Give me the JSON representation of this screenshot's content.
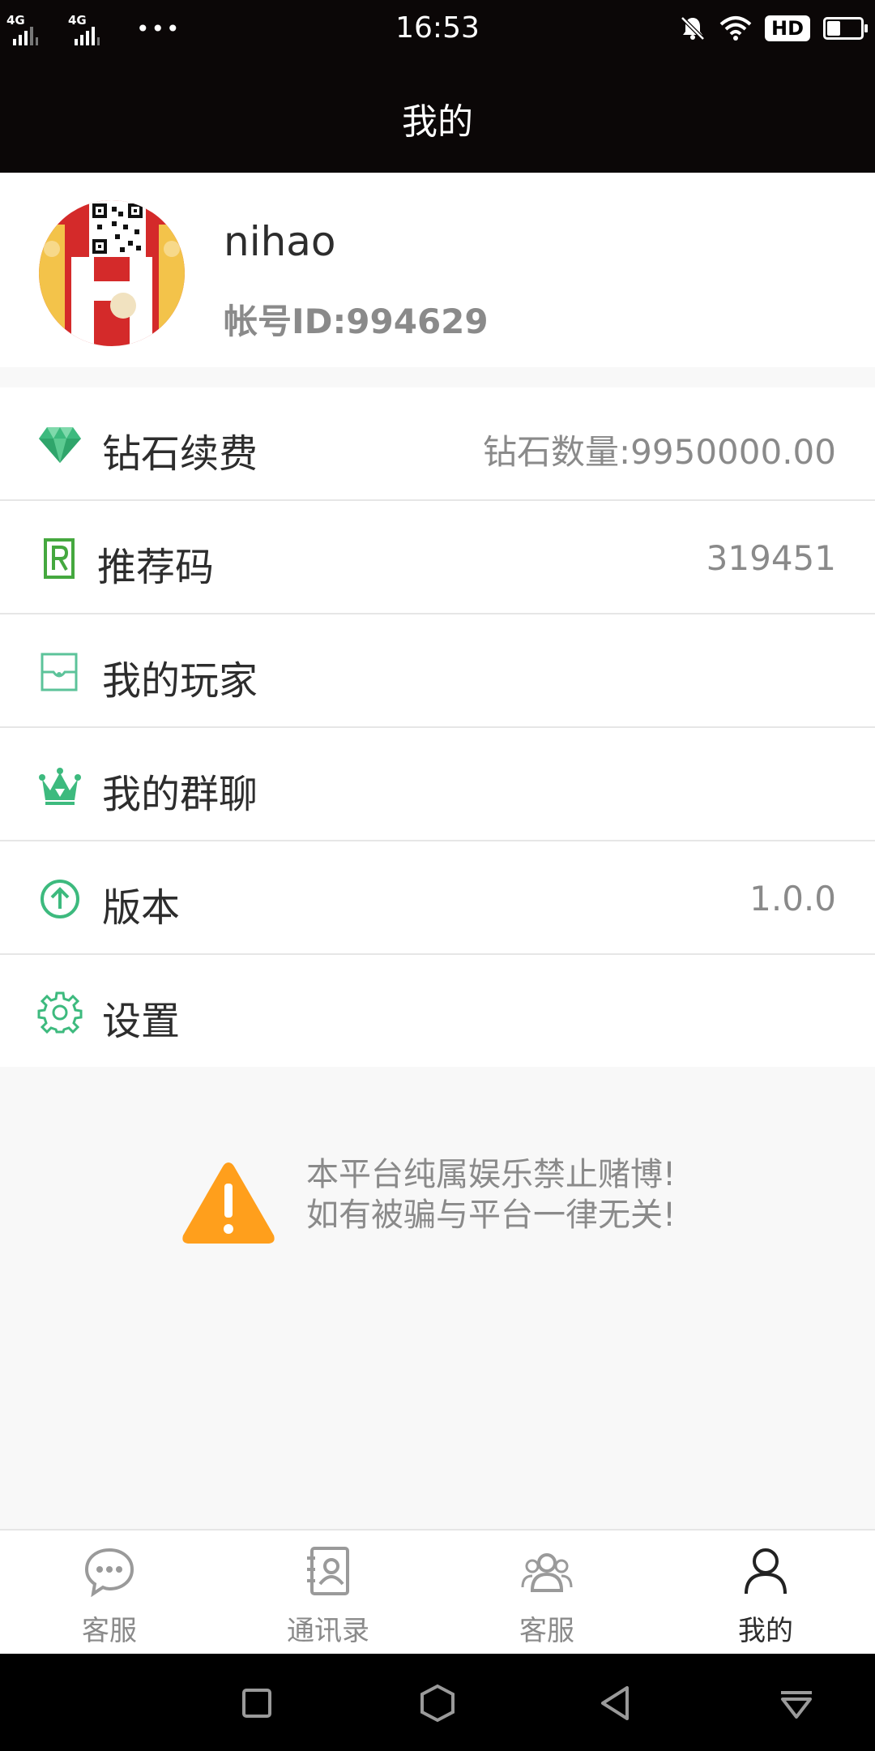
{
  "status_bar": {
    "network_1": "4G",
    "network_2": "4G",
    "more": "•••",
    "time": "16:53",
    "hd": "HD",
    "icons": [
      "mute-bell-icon",
      "wifi-icon",
      "battery-icon"
    ]
  },
  "header": {
    "title": "我的"
  },
  "profile": {
    "username": "nihao",
    "account_id": "帐号ID:994629"
  },
  "menu": {
    "items": [
      {
        "label": "钻石续费",
        "value": "钻石数量:9950000.00",
        "icon": "diamond-icon"
      },
      {
        "label": "推荐码",
        "value": "319451",
        "icon": "referral-r-icon"
      },
      {
        "label": "我的玩家",
        "value": "",
        "icon": "players-card-icon"
      },
      {
        "label": "我的群聊",
        "value": "",
        "icon": "crown-icon"
      },
      {
        "label": "版本",
        "value": "1.0.0",
        "icon": "upload-arrow-icon"
      },
      {
        "label": "设置",
        "value": "",
        "icon": "gear-icon"
      }
    ]
  },
  "disclaimer": {
    "line1": "本平台纯属娱乐禁止赌博!",
    "line2": "如有被骗与平台一律无关!",
    "icon": "warning-icon"
  },
  "tabbar": {
    "tabs": [
      {
        "label": "客服",
        "icon": "chat-bubble-icon",
        "active": false
      },
      {
        "label": "通讯录",
        "icon": "contacts-icon",
        "active": false
      },
      {
        "label": "客服",
        "icon": "group-icon",
        "active": false
      },
      {
        "label": "我的",
        "icon": "person-icon",
        "active": true
      }
    ]
  },
  "colors": {
    "header_bg": "#0b0707",
    "accent_green": "#3dba7e",
    "warning_orange": "#ff9f1c",
    "text_primary": "#2d2d2d",
    "text_secondary": "#8a8a8a"
  }
}
